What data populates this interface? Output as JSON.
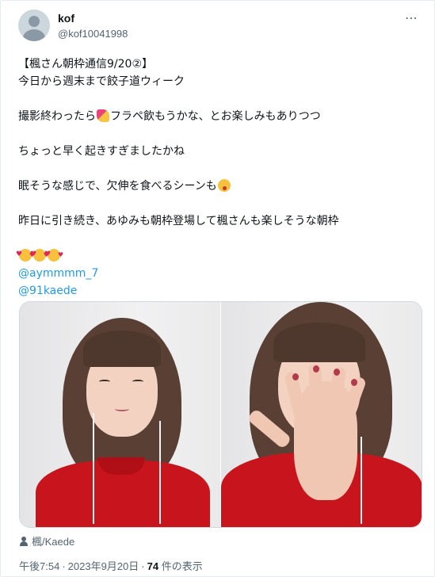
{
  "user": {
    "display_name": "kof",
    "handle": "@kof10041998",
    "more_icon": "⋯"
  },
  "tweet": {
    "line_1": "【楓さん朝枠通信9/20②】",
    "line_2": "今日から週末まで餃子道ウィーク",
    "line_3a": "撮影終わったら",
    "line_3b": "フラペ飲もうかな、とお楽しみもありつつ",
    "line_4": "ちょっと早く起きすぎましたかね",
    "line_5": "眠そうな感じで、欠伸を食べるシーンも",
    "line_6": "昨日に引き続き、あゆみも朝枠登場して楓さんも楽しそうな朝枠",
    "mention_1": "@aymmmm_7",
    "mention_2": "@91kaede"
  },
  "media": {
    "caption": "楓/Kaede"
  },
  "meta": {
    "time": "午後7:54",
    "date": "2023年9月20日",
    "views_count": "74",
    "views_label": "件の表示"
  }
}
